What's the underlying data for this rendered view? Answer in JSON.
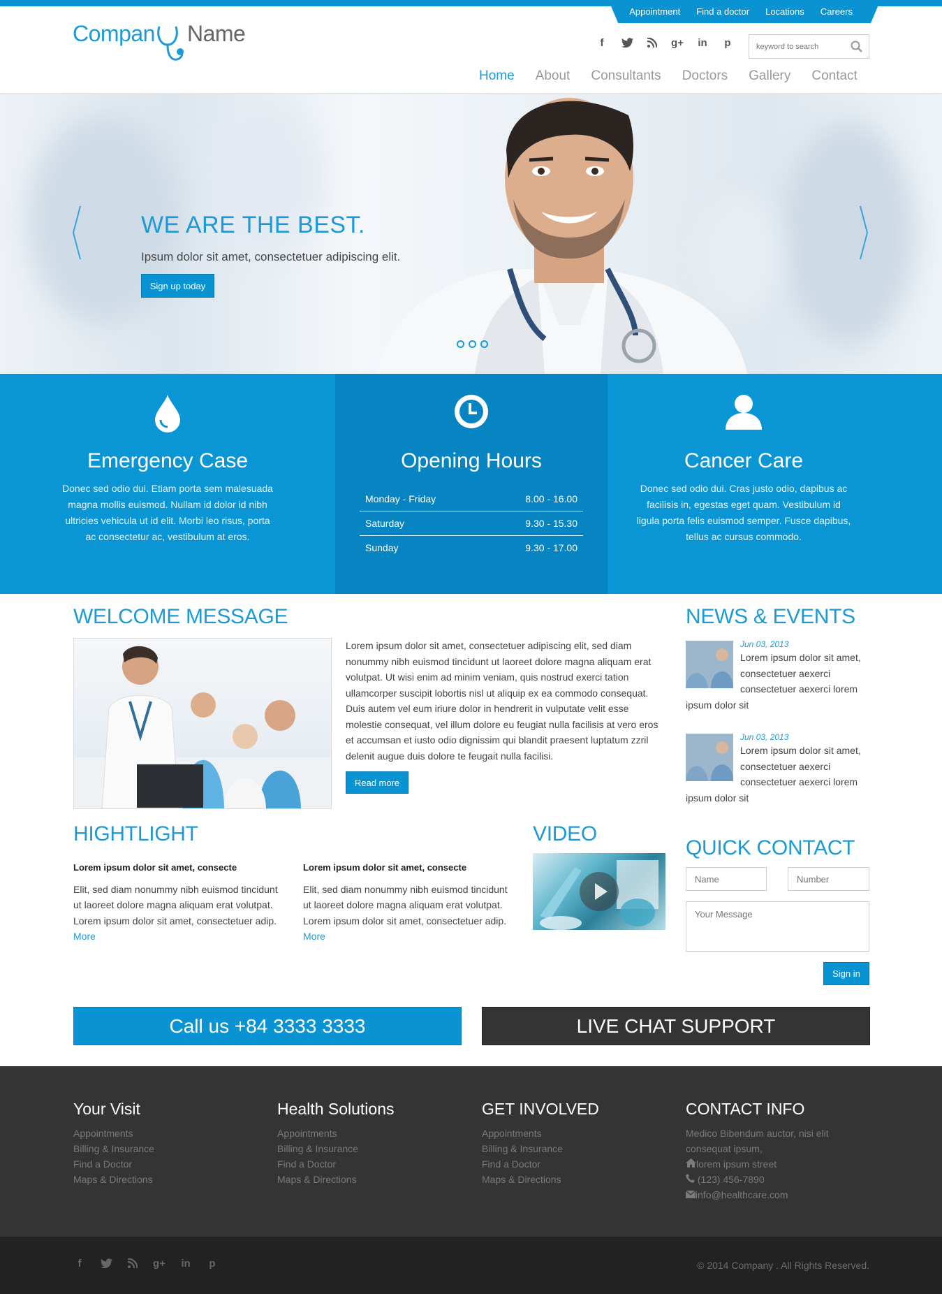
{
  "toplinks": [
    "Appointment",
    "Find a doctor",
    "Locations",
    "Careers"
  ],
  "logo": {
    "part1": "Compan",
    "part2": "Name"
  },
  "search": {
    "placeholder": "keyword to search"
  },
  "nav": [
    "Home",
    "About",
    "Consultants",
    "Doctors",
    "Gallery",
    "Contact"
  ],
  "hero": {
    "title": "WE ARE THE BEST.",
    "subtitle": "Ipsum dolor sit amet, consectetuer adipiscing elit.",
    "button": "Sign up today"
  },
  "features": {
    "emergency": {
      "title": "Emergency Case",
      "text": "Donec sed odio dui. Etiam porta sem malesuada magna mollis euismod. Nullam id dolor id nibh ultricies vehicula ut id elit. Morbi leo risus, porta ac consectetur ac, vestibulum at eros."
    },
    "hours": {
      "title": "Opening Hours",
      "rows": [
        {
          "day": "Monday - Friday",
          "time": "8.00 - 16.00"
        },
        {
          "day": "Saturday",
          "time": "9.30 - 15.30"
        },
        {
          "day": "Sunday",
          "time": "9.30 - 17.00"
        }
      ]
    },
    "cancer": {
      "title": "Cancer Care",
      "text": "Donec sed odio dui. Cras justo odio, dapibus ac facilisis in, egestas eget quam. Vestibulum id ligula porta felis euismod semper. Fusce dapibus, tellus ac cursus commodo."
    }
  },
  "welcome": {
    "title": "WELCOME MESSAGE",
    "text": "Lorem ipsum dolor sit amet, consectetuer adipiscing elit, sed diam nonummy nibh euismod tincidunt ut laoreet dolore magna aliquam erat volutpat. Ut wisi enim ad minim veniam, quis nostrud exerci tation ullamcorper suscipit lobortis nisl ut aliquip ex ea commodo consequat. Duis autem vel eum iriure dolor in hendrerit in vulputate velit esse molestie consequat, vel illum dolore eu feugiat nulla facilisis at vero eros et accumsan et iusto odio dignissim qui blandit praesent luptatum zzril delenit augue duis dolore te feugait nulla facilisi.",
    "button": "Read more"
  },
  "news": {
    "title": "NEWS & EVENTS",
    "items": [
      {
        "date": "Jun 03, 2013",
        "text": "Lorem ipsum dolor sit amet, consectetuer aexerci consectetuer aexerci lorem ipsum dolor sit"
      },
      {
        "date": "Jun 03, 2013",
        "text": "Lorem ipsum dolor sit amet, consectetuer aexerci consectetuer aexerci lorem ipsum dolor sit"
      }
    ]
  },
  "highlight": {
    "title": "HIGHTLIGHT",
    "items": [
      {
        "heading": "Lorem ipsum dolor sit amet, consecte",
        "text": "Elit, sed diam nonummy nibh euismod tincidunt ut laoreet dolore magna aliquam erat volutpat. Lorem ipsum dolor sit amet, consectetuer adip.",
        "more": "More"
      },
      {
        "heading": "Lorem ipsum dolor sit amet, consecte",
        "text": "Elit, sed diam nonummy nibh euismod tincidunt ut laoreet dolore magna aliquam erat volutpat. Lorem ipsum dolor sit amet, consectetuer adip.",
        "more": "More"
      }
    ]
  },
  "video": {
    "title": "VIDEO"
  },
  "quick_contact": {
    "title": "QUICK CONTACT",
    "name_placeholder": "Name",
    "number_placeholder": "Number",
    "message_placeholder": "Your Message",
    "button": "Sign in"
  },
  "cta": {
    "call": "Call us +84 3333 3333",
    "chat": "LIVE CHAT SUPPORT"
  },
  "footer": {
    "cols": [
      {
        "title": "Your Visit",
        "links": [
          "Appointments",
          "Billing & Insurance",
          "Find a Doctor",
          "Maps & Directions"
        ]
      },
      {
        "title": "Health Solutions",
        "links": [
          "Appointments",
          "Billing & Insurance",
          "Find a Doctor",
          "Maps & Directions"
        ]
      },
      {
        "title": "GET INVOLVED",
        "links": [
          "Appointments",
          "Billing & Insurance",
          "Find a Doctor",
          "Maps & Directions"
        ]
      }
    ],
    "contact": {
      "title": "CONTACT INFO",
      "line1": "Medico Bibendum auctor, nisi elit",
      "line2": "consequat ipsum,",
      "address": "lorem ipsum street",
      "phone": "(123) 456-7890",
      "email": "info@healthcare.com"
    },
    "copyright": "© 2014 Company . All Rights Reserved."
  },
  "social_icons": [
    "facebook-icon",
    "twitter-icon",
    "rss-icon",
    "google-plus-icon",
    "linkedin-icon",
    "pinterest-icon"
  ],
  "colors": {
    "accent": "#0993d3",
    "accent_dark": "#0785c2",
    "footer": "#343434",
    "footer_bottom": "#222222"
  }
}
